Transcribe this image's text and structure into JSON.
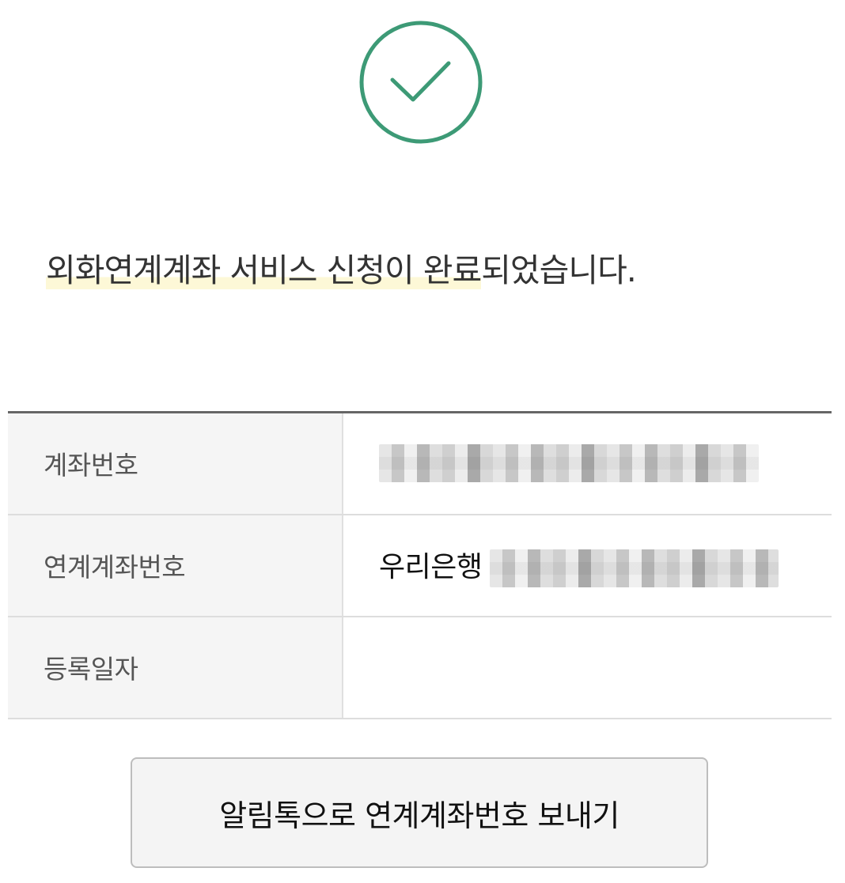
{
  "status_icon": "check-circle-icon",
  "accent_color": "#3d9a76",
  "highlight_color": "#fdf8d7",
  "message": {
    "highlighted": "외화연계계좌 서비스 신청이 완료",
    "rest": "되었습니다."
  },
  "details": [
    {
      "label": "계좌번호",
      "value": ""
    },
    {
      "label": "연계계좌번호",
      "bank": "우리은행",
      "value": ""
    },
    {
      "label": "등록일자",
      "value": ""
    }
  ],
  "send_button_label": "알림톡으로 연계계좌번호 보내기"
}
